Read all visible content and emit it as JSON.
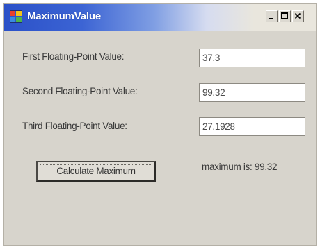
{
  "window": {
    "title": "MaximumValue",
    "app_icon": "form-icon",
    "controls": {
      "minimize_icon": "minimize-icon",
      "maximize_icon": "maximize-icon",
      "close_icon": "close-icon"
    }
  },
  "form": {
    "fields": [
      {
        "label": "First Floating-Point Value:",
        "value": "37.3"
      },
      {
        "label": "Second Floating-Point Value:",
        "value": "99.32"
      },
      {
        "label": "Third Floating-Point Value:",
        "value": "27.1928"
      }
    ],
    "calculate_button_label": "Calculate Maximum",
    "result_text": "maximum is: 99.32"
  },
  "colors": {
    "titlebar_start": "#2b51c8",
    "window_background": "#d7d4cc"
  }
}
